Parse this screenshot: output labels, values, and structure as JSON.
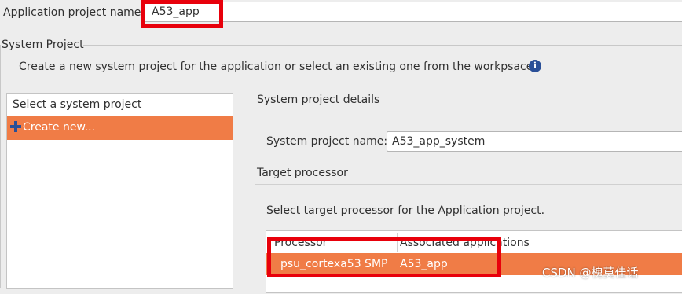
{
  "application": {
    "name_label": "Application project name:",
    "name_value": "A53_app"
  },
  "system_project": {
    "group_title": "System Project",
    "description": "Create a new system project for the application or select an existing one from the workpsace",
    "select_header": "Select a system project",
    "create_new_label": "Create new...",
    "details_title": "System project details",
    "name_label": "System project name:",
    "name_value": "A53_app_system"
  },
  "target_processor": {
    "title": "Target processor",
    "description": "Select target processor for the Application project.",
    "columns": [
      "Processor",
      "Associated applications"
    ],
    "rows": [
      {
        "processor": "psu_cortexa53 SMP",
        "apps": "A53_app"
      }
    ]
  },
  "watermark": "CSDN @槐莫佳话",
  "colors": {
    "selection": "#f07c46",
    "highlight_box": "#e8000b",
    "info_icon": "#2a4f97"
  },
  "icons": {
    "info": "info-icon",
    "create": "plus-icon"
  }
}
